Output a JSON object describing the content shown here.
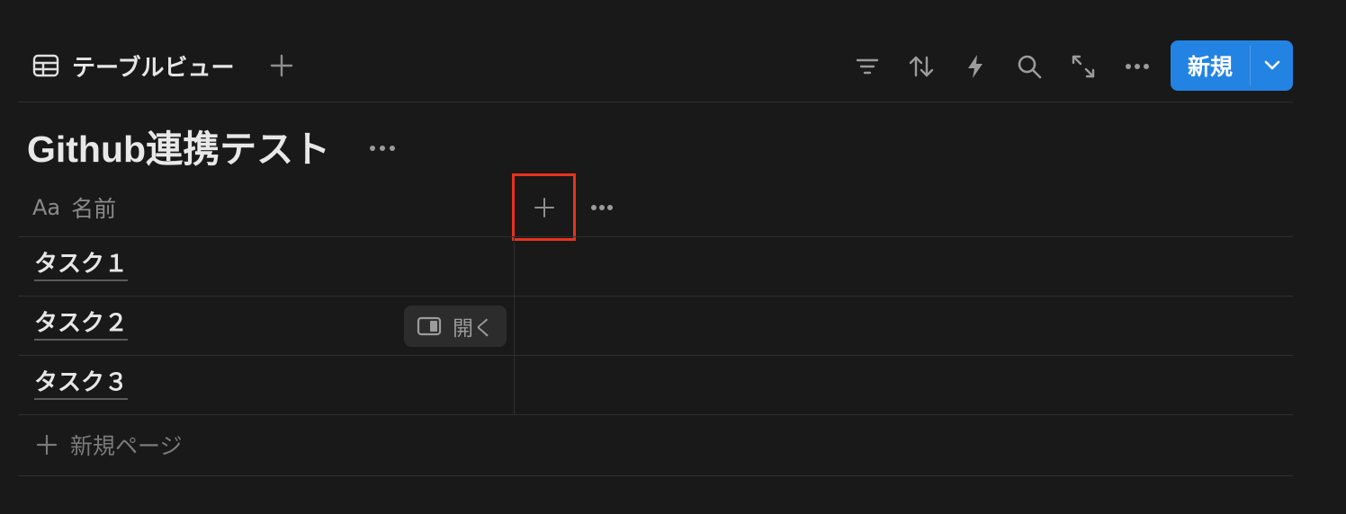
{
  "toolbar": {
    "view_name": "テーブルビュー",
    "view_icon": "table-icon",
    "add_view_icon": "plus-icon",
    "tools": [
      "filter-icon",
      "sort-icon",
      "automation-icon",
      "search-icon",
      "expand-icon",
      "more-icon"
    ],
    "new_button_label": "新規",
    "new_button_color": "#2383e2"
  },
  "database": {
    "title": "Github連携テスト"
  },
  "table": {
    "columns": [
      {
        "icon_text": "Aa",
        "label": "名前"
      }
    ],
    "add_property_highlight_color": "#e8321e",
    "rows": [
      {
        "name": "タスク１"
      },
      {
        "name": "タスク２",
        "open_label": "開く"
      },
      {
        "name": "タスク３"
      }
    ],
    "new_page_label": "新規ページ"
  }
}
